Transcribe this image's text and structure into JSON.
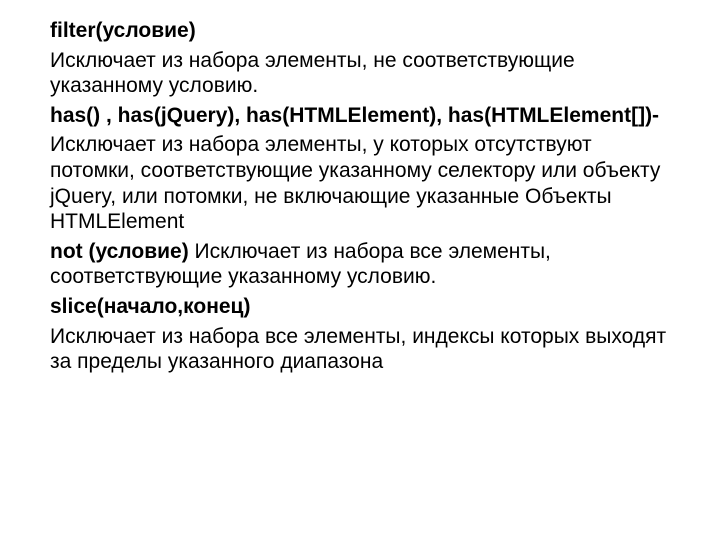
{
  "entries": {
    "filter_title": "filter(условие)",
    "filter_desc": "Исключает из набора элементы, не соответствующие указанному условию.",
    "has_title": "has() , has(jQuery), has(HTMLElement), has(HTMLElement[])-",
    "has_desc": "Исключает из набора элементы, у которых отсутствуют потомки, соответствующие указанному селектору или объекту jQuery, или потомки, не включающие указанные Объекты HTMLElement",
    "not_title": "not (условие) ",
    "not_desc": "Исключает из набора все элементы, соответствующие указанному условию.",
    "slice_title": "slice(начало,конец)",
    "slice_desc": "Исключает из набора все элементы, индексы которых выходят за пределы указанного диапазона"
  }
}
